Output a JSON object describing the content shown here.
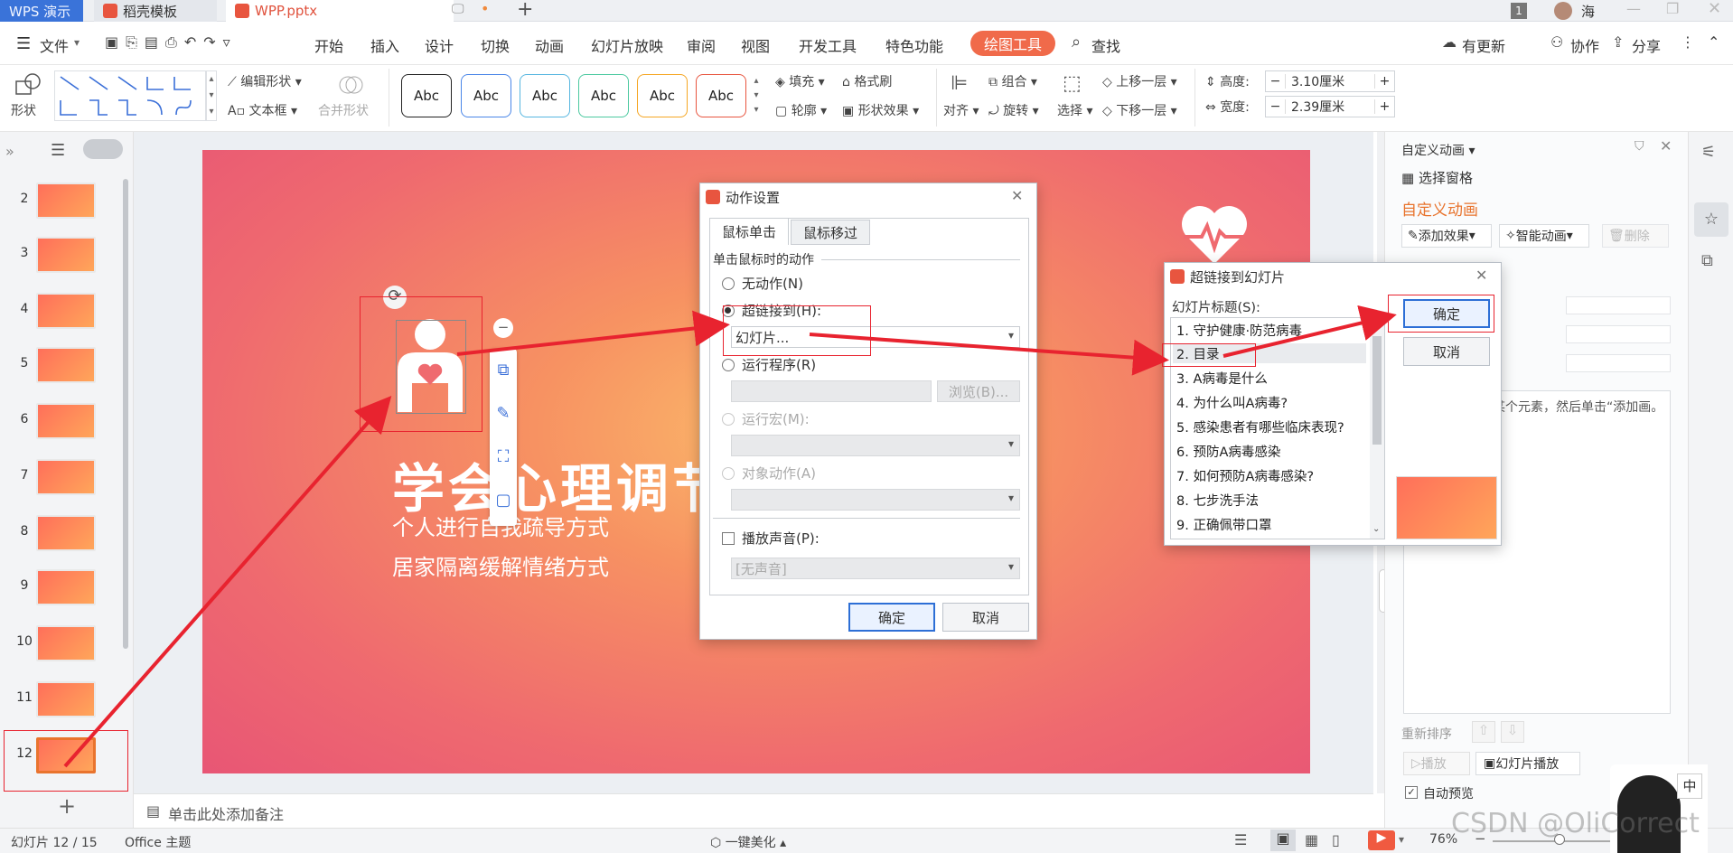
{
  "titlebar": {
    "tabs": [
      "WPS 演示",
      "稻壳模板",
      "WPP.pptx"
    ],
    "window_count": "1",
    "user": "海"
  },
  "menubar": {
    "file_label": "文件",
    "items": [
      "开始",
      "插入",
      "设计",
      "切换",
      "动画",
      "幻灯片放映",
      "审阅",
      "视图",
      "开发工具",
      "特色功能"
    ],
    "drawing_tools": "绘图工具",
    "search": "查找",
    "right_items": [
      "有更新",
      "协作",
      "分享"
    ]
  },
  "ribbon": {
    "shape_label": "形状",
    "edit_shape": "编辑形状",
    "text_box": "文本框",
    "merge_shape": "合并形状",
    "style_samples": [
      "Abc",
      "Abc",
      "Abc",
      "Abc",
      "Abc",
      "Abc"
    ],
    "style_colors": [
      "#222222",
      "#4a86e8",
      "#57b6e0",
      "#4cc9a0",
      "#f5a623",
      "#e8553f"
    ],
    "fill": "填充",
    "format_painter": "格式刷",
    "outline": "轮廓",
    "shape_effect": "形状效果",
    "align": "对齐",
    "group": "组合",
    "rotate": "旋转",
    "select": "选择",
    "bring_forward": "上移一层",
    "send_backward": "下移一层",
    "height_label": "高度:",
    "height_value": "3.10厘米",
    "width_label": "宽度:",
    "width_value": "2.39厘米"
  },
  "slides_panel": {
    "numbers": [
      "2",
      "3",
      "4",
      "5",
      "6",
      "7",
      "8",
      "9",
      "10",
      "11",
      "12"
    ],
    "active": "12",
    "add_icon": "plus-icon"
  },
  "slide": {
    "title": "学会心理调节",
    "line1": "个人进行自我疏导方式",
    "line2": "居家隔离缓解情绪方式"
  },
  "notes_placeholder": "单击此处添加备注",
  "action_dialog": {
    "title": "动作设置",
    "tabs": [
      "鼠标单击",
      "鼠标移过"
    ],
    "section": "单击鼠标时的动作",
    "none": "无动作(N)",
    "hyperlink": "超链接到(H):",
    "hyperlink_value": "幻灯片...",
    "run_program": "运行程序(R)",
    "browse": "浏览(B)...",
    "run_macro": "运行宏(M):",
    "object_action": "对象动作(A)",
    "play_sound": "播放声音(P):",
    "sound_value": "[无声音]",
    "ok": "确定",
    "cancel": "取消"
  },
  "hyperlink_dialog": {
    "title": "超链接到幻灯片",
    "list_label": "幻灯片标题(S):",
    "items": [
      "1. 守护健康·防范病毒",
      "2. 目录",
      "3. A病毒是什么",
      "4. 为什么叫A病毒?",
      "5. 感染患者有哪些临床表现?",
      "6. 预防A病毒感染",
      "7. 如何预防A病毒感染?",
      "8. 七步洗手法",
      "9. 正确佩带口罩"
    ],
    "selected": "2. 目录",
    "ok": "确定",
    "cancel": "取消"
  },
  "animation_panel": {
    "header": "自定义动画",
    "selection_pane": "选择窗格",
    "title": "自定义动画",
    "add_effect": "添加效果",
    "smart_anim": "智能动画",
    "delete": "删除",
    "hint": "某个元素，然后单击“添加画。",
    "reorder": "重新排序",
    "play": "播放",
    "slideshow": "幻灯片播放",
    "auto_preview": "自动预览"
  },
  "statusbar": {
    "slide_info": "幻灯片 12 / 15",
    "theme": "Office 主题",
    "beautify": "一键美化",
    "zoom": "76%",
    "ime": "中",
    "watermark": "CSDN @OliCorrect"
  }
}
